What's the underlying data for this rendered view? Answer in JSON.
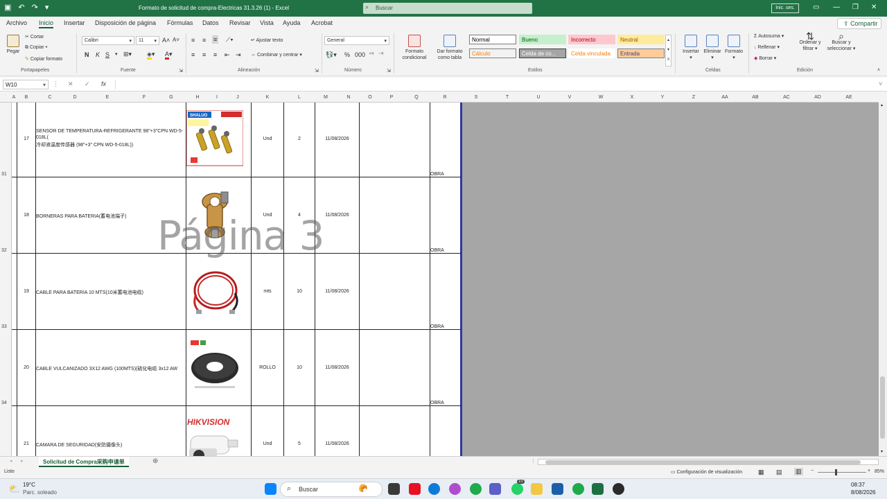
{
  "window": {
    "title": "Formato de solicitud de compra-Electricas 31.3.26 (1)  -  Excel",
    "search_placeholder": "Buscar",
    "signin": "Inic. ses.",
    "share": "Compartir"
  },
  "menu": [
    "Archivo",
    "Inicio",
    "Insertar",
    "Disposición de página",
    "Fórmulas",
    "Datos",
    "Revisar",
    "Vista",
    "Ayuda",
    "Acrobat"
  ],
  "ribbon": {
    "clipboard": {
      "paste": "Pegar",
      "cut": "Cortar",
      "copy": "Copiar",
      "format_painter": "Copiar formato",
      "label": "Portapapeles"
    },
    "font": {
      "name": "Calibri",
      "size": "11",
      "label": "Fuente",
      "bold": "N",
      "italic": "K",
      "underline": "S"
    },
    "alignment": {
      "wrap": "Ajustar texto",
      "merge": "Combinar y centrar",
      "label": "Alineación"
    },
    "number": {
      "format": "General",
      "label": "Número"
    },
    "styles": {
      "cond_format": "Formato condicional",
      "as_table": "Dar formato como tabla",
      "label": "Estilos",
      "cells": [
        {
          "text": "Normal",
          "bg": "#ffffff",
          "fg": "#000000",
          "border": "#7a7a7a"
        },
        {
          "text": "Bueno",
          "bg": "#c6efce",
          "fg": "#006100",
          "border": "#c6efce"
        },
        {
          "text": "Incorrecto",
          "bg": "#ffc7ce",
          "fg": "#9c0006",
          "border": "#ffc7ce"
        },
        {
          "text": "Neutral",
          "bg": "#ffeb9c",
          "fg": "#9c5700",
          "border": "#ffeb9c"
        },
        {
          "text": "Cálculo",
          "bg": "#f2f2f2",
          "fg": "#fa7d00",
          "border": "#7f7f7f"
        },
        {
          "text": "Celda de co...",
          "bg": "#a5a5a5",
          "fg": "#ffffff",
          "border": "#3f3f3f"
        },
        {
          "text": "Celda vinculada",
          "bg": "#ffffff",
          "fg": "#fa7d00",
          "border": "#ffffff"
        },
        {
          "text": "Entrada",
          "bg": "#ffcc99",
          "fg": "#3f3f76",
          "border": "#7f7f7f"
        }
      ]
    },
    "cells": {
      "insert": "Insertar",
      "delete": "Eliminar",
      "format": "Formato",
      "label": "Celdas"
    },
    "editing": {
      "autosum": "Autosuma",
      "fill": "Rellenar",
      "clear": "Borrar",
      "sort": "Ordenar y filtrar",
      "find": "Buscar y seleccionar",
      "label": "Edición"
    }
  },
  "formula_bar": {
    "name_box": "W10",
    "formula": ""
  },
  "columns": [
    "A",
    "B",
    "C",
    "D",
    "E",
    "F",
    "G",
    "H",
    "I",
    "J",
    "K",
    "L",
    "M",
    "N",
    "O",
    "P",
    "Q",
    "R",
    "S",
    "T",
    "U",
    "V",
    "W",
    "X",
    "Y",
    "Z",
    "AA",
    "AB",
    "AC",
    "AD",
    "AE"
  ],
  "rows": [
    {
      "row_num": "31",
      "item": "17",
      "desc1": "SENSOR DE TEMPERATURA-REFRIGERANTE 98\"+3\"CPN WD-5-",
      "desc2": "018L(",
      "desc3": "冷却液温度传感器 (98\"+3\" CPN WD-5-018L))",
      "image": "SHALUO",
      "unit": "Und",
      "qty": "2",
      "date": "11/08/2026",
      "dest": "OBRA"
    },
    {
      "row_num": "32",
      "item": "18",
      "desc1": "BORNERAS PARA BATERIA(蓄电池端子)",
      "desc2": "",
      "desc3": "",
      "image": "",
      "unit": "Und",
      "qty": "4",
      "date": "11/08/2026",
      "dest": "OBRA"
    },
    {
      "row_num": "33",
      "item": "19",
      "desc1": "CABLE PARA BATERIA 10 MTS(10米蓄电池电缆)",
      "desc2": "",
      "desc3": "",
      "image": "",
      "unit": "mts",
      "qty": "10",
      "date": "11/08/2026",
      "dest": "OBRA"
    },
    {
      "row_num": "34",
      "item": "20",
      "desc1": "CABLE VULCANIZADO 3X12 AWG (100MTS)(硫化电缆 3x12 AW",
      "desc2": "",
      "desc3": "",
      "image": "",
      "unit": "ROLLO",
      "qty": "10",
      "date": "11/08/2026",
      "dest": "OBRA"
    },
    {
      "row_num": "",
      "item": "21",
      "desc1": "CAMARA DE SEGURIDAD(安防摄像头)",
      "desc2": "",
      "desc3": "",
      "image": "HIKVISION",
      "unit": "Und",
      "qty": "5",
      "date": "11/08/2026",
      "dest": ""
    }
  ],
  "watermark": "Página 3",
  "sheet_tab": "Solicitud de Compra采购申请单",
  "status": {
    "ready": "Listo",
    "display_settings": "Configuración de visualización",
    "zoom": "85%"
  },
  "taskbar": {
    "temp": "19°C",
    "weather": "Parc. soleado",
    "search": "Buscar",
    "time": "08:37",
    "date": "8/08/2026",
    "badge": "10"
  }
}
